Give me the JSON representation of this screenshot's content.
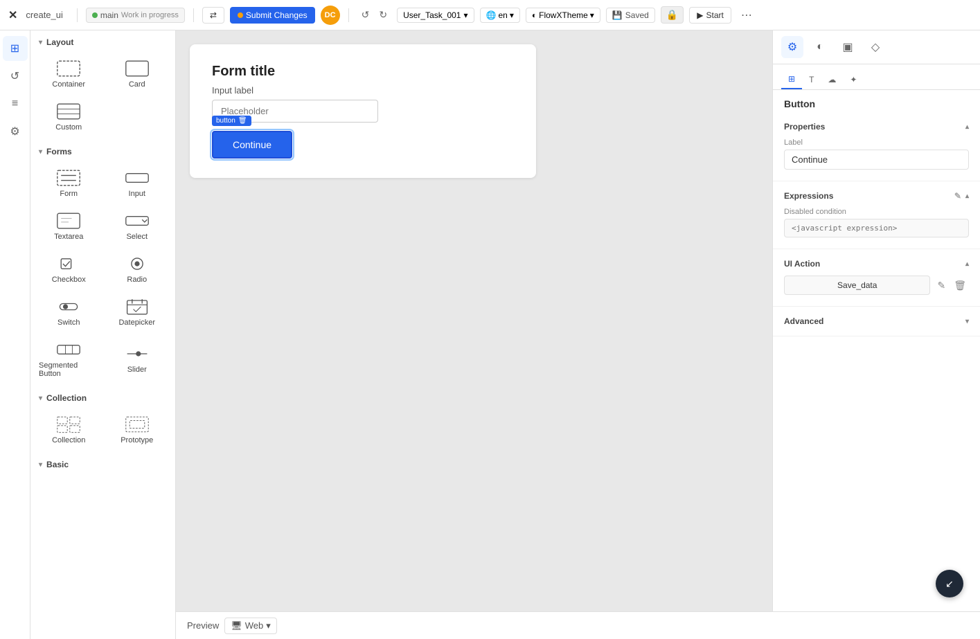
{
  "topbar": {
    "logo": "✕",
    "app_name": "create_ui",
    "branch_name": "main",
    "branch_status": "Work in progress",
    "submit_btn": "Submit Changes",
    "task_select": "User_Task_001",
    "lang": "en",
    "theme": "FlowXTheme",
    "saved_label": "Saved",
    "start_btn": "Start",
    "avatar_initials": "DC"
  },
  "left_panel": {
    "layout_section": "Layout",
    "forms_section": "Forms",
    "collection_section": "Collection",
    "basic_section": "Basic",
    "layout_items": [
      {
        "id": "container",
        "label": "Container"
      },
      {
        "id": "card",
        "label": "Card"
      },
      {
        "id": "custom",
        "label": "Custom"
      }
    ],
    "form_items": [
      {
        "id": "form",
        "label": "Form"
      },
      {
        "id": "input",
        "label": "Input"
      },
      {
        "id": "textarea",
        "label": "Textarea"
      },
      {
        "id": "select",
        "label": "Select"
      },
      {
        "id": "checkbox",
        "label": "Checkbox"
      },
      {
        "id": "radio",
        "label": "Radio"
      },
      {
        "id": "switch",
        "label": "Switch"
      },
      {
        "id": "datepicker",
        "label": "Datepicker"
      },
      {
        "id": "segmented-button",
        "label": "Segmented Button"
      },
      {
        "id": "slider",
        "label": "Slider"
      }
    ],
    "collection_items": [
      {
        "id": "collection",
        "label": "Collection"
      },
      {
        "id": "prototype",
        "label": "Prototype"
      }
    ]
  },
  "canvas": {
    "form_title": "Form title",
    "input_label": "Input label",
    "input_placeholder": "Placeholder",
    "button_tag": "button",
    "button_label": "Continue"
  },
  "right_panel": {
    "component_title": "Button",
    "tabs": [
      {
        "id": "settings",
        "label": "Settings",
        "icon": "⚙"
      },
      {
        "id": "style",
        "label": "Style",
        "icon": "◐"
      },
      {
        "id": "responsive",
        "label": "Responsive",
        "icon": "▣"
      },
      {
        "id": "actions",
        "label": "Actions",
        "icon": "◇"
      }
    ],
    "inner_tabs": [
      {
        "id": "layout",
        "label": "⊞",
        "icon": "grid"
      },
      {
        "id": "text",
        "label": "T",
        "icon": "text"
      },
      {
        "id": "cloud",
        "label": "☁",
        "icon": "cloud"
      },
      {
        "id": "star",
        "label": "✦",
        "icon": "star"
      }
    ],
    "properties_section": "Properties",
    "label_field": "Label",
    "label_value": "Continue",
    "expressions_section": "Expressions",
    "disabled_condition_label": "Disabled condition",
    "disabled_condition_placeholder": "<javascript expression>",
    "ui_action_section": "UI Action",
    "action_value": "Save_data",
    "advanced_section": "Advanced",
    "edit_icon": "✎",
    "delete_icon": "🗑"
  },
  "preview": {
    "label": "Preview",
    "mode": "Web"
  },
  "icons": {
    "chevron_down": "▾",
    "chevron_up": "▴",
    "globe": "🌐",
    "undo": "↺",
    "redo": "↻",
    "lock": "🔒",
    "play": "▶",
    "more": "⋯",
    "trash": "🗑",
    "edit": "✎",
    "plus": "↙"
  }
}
